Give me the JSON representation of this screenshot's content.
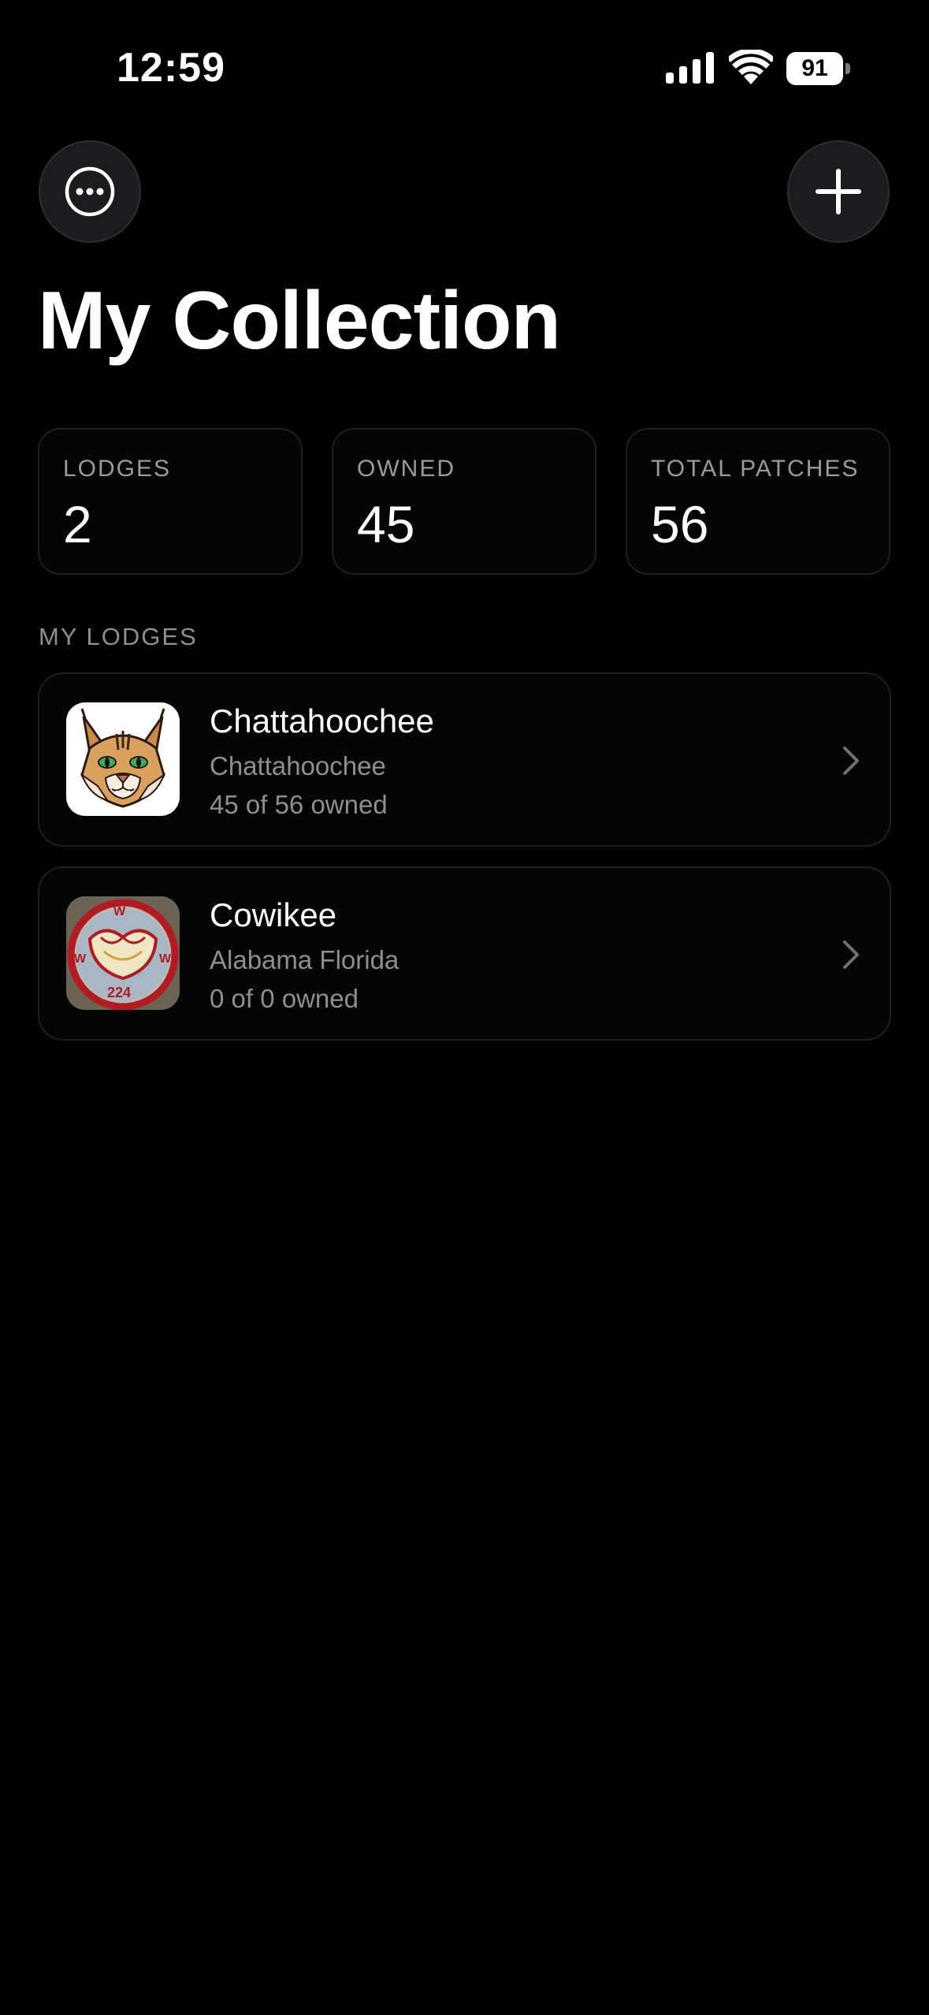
{
  "status_bar": {
    "time": "12:59",
    "battery": "91"
  },
  "toolbar": {
    "more_icon": "ellipsis-circle-icon",
    "add_icon": "plus-icon"
  },
  "title": "My Collection",
  "stats": [
    {
      "label": "LODGES",
      "value": "2"
    },
    {
      "label": "OWNED",
      "value": "45"
    },
    {
      "label": "TOTAL PATCHES",
      "value": "56"
    }
  ],
  "section_header": "MY LODGES",
  "lodges": [
    {
      "name": "Chattahoochee",
      "subtitle": "Chattahoochee",
      "owned": "45 of 56 owned",
      "thumb_icon": "bobcat-logo"
    },
    {
      "name": "Cowikee",
      "subtitle": "Alabama Florida",
      "owned": "0 of 0 owned",
      "thumb_icon": "patch-photo"
    }
  ],
  "colors": {
    "background": "#000000",
    "card_border": "#1f1f21",
    "secondary_text": "#8e8e93",
    "button_bg": "#1c1c1e"
  }
}
